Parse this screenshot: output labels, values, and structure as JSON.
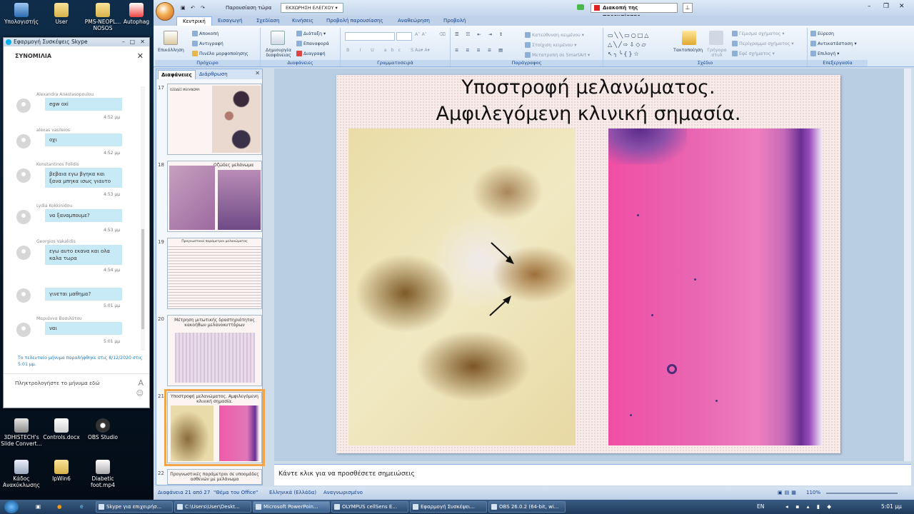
{
  "desktop": {
    "icons": [
      {
        "label": "Υπολογιστής",
        "x": "computer-icon"
      },
      {
        "label": "User",
        "x": "folder-icon"
      },
      {
        "label": "PMS-NEOPL... NOSOS",
        "x": "folder-icon"
      },
      {
        "label": "Autophag",
        "x": "pdf-icon"
      },
      {
        "label": "3DHISTECH's Slide Convert...",
        "x": "app-icon"
      },
      {
        "label": "Controls.docx",
        "x": "doc-icon"
      },
      {
        "label": "OBS Studio",
        "x": "obs-icon"
      },
      {
        "label": "Κάδος Ανακύκλωσης",
        "x": "recycle-bin-icon"
      },
      {
        "label": "IpWin6",
        "x": "folder-icon"
      },
      {
        "label": "Diabetic foot.mp4",
        "x": "video-icon"
      }
    ]
  },
  "skype": {
    "window_title": "Εφαρμογή Συσκέψεις Skype",
    "header": "ΣΥΝΟΜΙΛΙΑ",
    "messages": [
      {
        "name": "Alexandra Anastasopoulou",
        "text": "egw oxi",
        "time": "4:52 μμ"
      },
      {
        "name": "alexas vasileios",
        "text": "οχι",
        "time": "4:52 μμ"
      },
      {
        "name": "Konstantinos Folidis",
        "text": "βεβαια εγω βγηκα και ξανα μπηκα ισως γιαυτο",
        "time": "4:53 μμ"
      },
      {
        "name": "Lydia Kokkinidou",
        "text": "να ξαναμπουμε?",
        "time": "4:53 μμ"
      },
      {
        "name": "Georgios Vakalidis",
        "text": "εγω αυτο εκανα και ολα καλα τωρα",
        "time": "4:54 μμ"
      },
      {
        "name": "",
        "text": "γινεται μαθημα?",
        "time": "5:01 μμ"
      },
      {
        "name": "Μαριάννα Βασιλάτου",
        "text": "ναι",
        "time": "5:01 μμ"
      }
    ],
    "last_seen": "Το τελευταίο μήνυμα παραλήφθηκε στις 8/12/2020 στις 5:01 μμ.",
    "input_placeholder": "Πληκτρολογήστε το μήνυμα εδώ"
  },
  "ppt": {
    "present_label": "Παρουσίαση τώρα",
    "control_dropdown": "ΕΚΧΩΡΗΣΗ ΕΛΕΓΧΟΥ",
    "stop_button": "Διακοπή της παρουσίασης",
    "tabs": [
      "Κεντρική",
      "Εισαγωγή",
      "Σχεδίαση",
      "Κινήσεις",
      "Προβολή παρουσίασης",
      "Αναθεώρηση",
      "Προβολή"
    ],
    "ribbon": {
      "clipboard": {
        "label": "Πρόχειρο",
        "paste": "Επικόλληση",
        "cut": "Αποκοπή",
        "copy": "Αντιγραφή",
        "painter": "Πινέλο μορφοποίησης"
      },
      "slides": {
        "label": "Διαφάνειες",
        "new_slide": "Δημιουργία διαφάνειας",
        "layout": "Διάταξη",
        "reset": "Επαναφορά",
        "delete": "Διαγραφή"
      },
      "font": {
        "label": "Γραμματοσειρά"
      },
      "paragraph": {
        "label": "Παράγραφος",
        "direction": "Κατεύθυνση κειμένου",
        "align": "Στοίχιση κειμένου",
        "smartart": "Μετατροπή σε SmartArt"
      },
      "drawing": {
        "label": "Σχέδιο",
        "arrange": "Τακτοποίηση",
        "quick": "Γρήγορα στυλ",
        "fill": "Γέμισμα σχήματος",
        "outline": "Περίγραμμα σχήματος",
        "effects": "Εφέ σχήματος"
      },
      "editing": {
        "label": "Επεξεργασία",
        "find": "Εύρεση",
        "replace": "Αντικατάσταση",
        "select": "Επιλογή"
      }
    },
    "panel_tabs": [
      "Διαφάνειες",
      "Διάρθρωση"
    ],
    "thumbnails": [
      {
        "num": "17",
        "title": "ΟΖΩΔΕΣ ΜΕΛΑΝΩΜΑ"
      },
      {
        "num": "18",
        "title": "Οζώδες μελάνωμα"
      },
      {
        "num": "19",
        "title": "Προγνωστικοί παράμετροι μελανώματος"
      },
      {
        "num": "20",
        "title": "Μέτρηση μιτωτικής δραστηριότητας κακοήθων μελανοκυττάρων"
      },
      {
        "num": "21",
        "title": "Υποστροφή μελανώματος. Αμφιλεγόμενη κλινική σημασία."
      },
      {
        "num": "22",
        "title": "Προγνωστικές παράμετροι σε υποομάδες ασθενών με μελάνωμα"
      }
    ],
    "slide": {
      "title_line1": "Υποστροφή μελανώματος.",
      "title_line2": "Αμφιλεγόμενη κλινική σημασία."
    },
    "notes_placeholder": "Κάντε κλικ για να προσθέσετε σημειώσεις",
    "status": {
      "slide": "Διαφάνεια 21 από 27",
      "theme": "\"Θέμα του Office\"",
      "language": "Ελληνικά (Ελλάδα)",
      "recognized": "Αναγνωρισμένο",
      "zoom": "110%"
    }
  },
  "taskbar": {
    "items": [
      "Skype για επιχειρήσ...",
      "C:\\Users\\User\\Deskt...",
      "Microsoft PowerPoin...",
      "OLYMPUS cellSens E...",
      "Εφαρμογή Συσκέψει...",
      "OBS 26.0.2 (64-bit, wi..."
    ],
    "lang": "EN",
    "time": "5:01 μμ"
  }
}
